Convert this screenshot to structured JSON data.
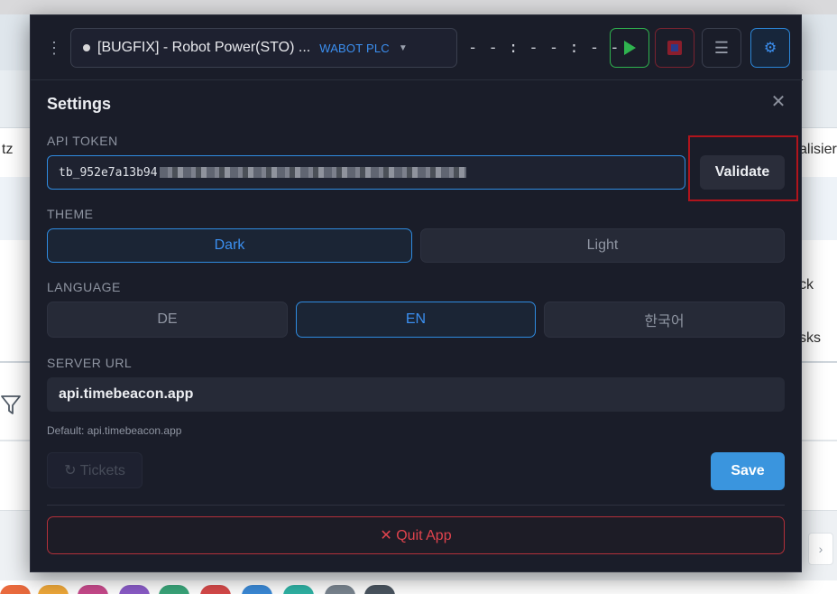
{
  "background": {
    "texts": [
      "tz",
      "alisier",
      "ck",
      "sks"
    ],
    "pager_icon": "chevron-right-icon",
    "pager_glyph": "›",
    "filter_icon": "filter-icon"
  },
  "topbar": {
    "task_name": "[BUGFIX] - Robot Power(STO) ...",
    "task_client": "WABOT PLC",
    "timer": "- - : - - : - -",
    "icons": [
      "menu-kebab-icon",
      "play-icon",
      "stop-icon",
      "list-icon",
      "gear-icon"
    ]
  },
  "settings": {
    "title": "Settings",
    "api_token": {
      "label": "API TOKEN",
      "value_visible": "tb_952e7a13b94",
      "validate_label": "Validate"
    },
    "theme": {
      "label": "THEME",
      "options": [
        "Dark",
        "Light"
      ],
      "selected": "Dark"
    },
    "language": {
      "label": "LANGUAGE",
      "options": [
        "DE",
        "EN",
        "한국어"
      ],
      "selected": "EN"
    },
    "server_url": {
      "label": "SERVER URL",
      "value": "api.timebeacon.app",
      "hint": "Default: api.timebeacon.app"
    },
    "tickets_label": "↻ Tickets",
    "save_label": "Save",
    "quit_label": "✕ Quit App"
  },
  "colors": {
    "accent": "#3b8ff0",
    "play": "#2fb34f",
    "stop": "#7a2330",
    "danger": "#e0434d",
    "save": "#3a95de",
    "highlight": "#b0141c"
  }
}
